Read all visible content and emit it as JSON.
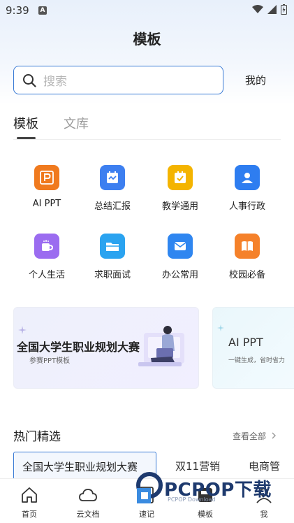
{
  "status_bar": {
    "time": "9:39",
    "badge": "A"
  },
  "header": {
    "title": "模板"
  },
  "search": {
    "placeholder": "搜索",
    "mine_label": "我的"
  },
  "tabs": [
    {
      "label": "模板",
      "active": true
    },
    {
      "label": "文库",
      "active": false
    }
  ],
  "categories": [
    {
      "label": "AI PPT",
      "icon": "ppt-icon",
      "color": "#f07a1e"
    },
    {
      "label": "总结汇报",
      "icon": "calendar-chart-icon",
      "color": "#3d7ff0"
    },
    {
      "label": "教学通用",
      "icon": "checklist-icon",
      "color": "#f4b400"
    },
    {
      "label": "人事行政",
      "icon": "person-card-icon",
      "color": "#2e7df0"
    },
    {
      "label": "个人生活",
      "icon": "cup-icon",
      "color": "#9b6cf0"
    },
    {
      "label": "求职面试",
      "icon": "folder-icon",
      "color": "#2aa3f0"
    },
    {
      "label": "办公常用",
      "icon": "mail-icon",
      "color": "#2f86f0"
    },
    {
      "label": "校园必备",
      "icon": "book-icon",
      "color": "#f5812a"
    }
  ],
  "banners": [
    {
      "title": "全国大学生职业规划大赛",
      "subtitle": "参赛PPT模板"
    },
    {
      "title": "AI PPT",
      "subtitle": "一键生成，省时省力"
    }
  ],
  "hot": {
    "title": "热门精选",
    "see_all": "查看全部"
  },
  "chips": [
    {
      "label": "全国大学生职业规划大赛",
      "active": true
    },
    {
      "label": "双11营销",
      "active": false
    },
    {
      "label": "电商管",
      "active": false
    }
  ],
  "bottom_nav": [
    {
      "label": "首页",
      "icon": "home-icon"
    },
    {
      "label": "云文档",
      "icon": "cloud-icon"
    },
    {
      "label": "速记",
      "icon": "note-icon"
    },
    {
      "label": "模板",
      "icon": "template-icon"
    },
    {
      "label": "我",
      "icon": "user-icon"
    }
  ],
  "watermark": {
    "text": "PCPOP下载",
    "sub": "PCPOP Download"
  },
  "colors": {
    "accent": "#3a7bd5"
  }
}
